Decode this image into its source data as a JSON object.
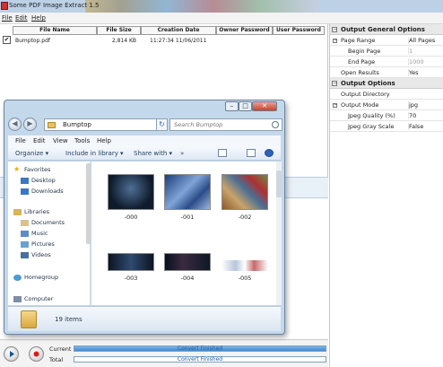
{
  "app": {
    "title": "Some PDF Image Extract 1.5",
    "menu": [
      "File",
      "Edit",
      "Help"
    ]
  },
  "file_table": {
    "columns": [
      "File Name",
      "File Size",
      "Creation Date",
      "Owner Password",
      "User Password"
    ],
    "rows": [
      {
        "checked": "✔",
        "name": "Bumptop.pdf",
        "size": "2,814 KB",
        "date": "11:27:34 11/06/2011",
        "owner": "",
        "user": ""
      }
    ]
  },
  "props": {
    "general_title": "Output General Options",
    "general": [
      {
        "key": "Page Range",
        "value": "All Pages"
      },
      {
        "key": "Begin Page",
        "value": "1"
      },
      {
        "key": "End Page",
        "value": "1000"
      },
      {
        "key": "Open Results",
        "value": "Yes"
      }
    ],
    "options_title": "Output Options",
    "options": [
      {
        "key": "Output Directory",
        "value": ""
      },
      {
        "key": "Output Mode",
        "value": "jpg"
      },
      {
        "key": "Jpeg Quality (%)",
        "value": "70"
      },
      {
        "key": "Jpeg Gray Scale",
        "value": "False"
      }
    ]
  },
  "progress": {
    "current_label": "Current",
    "total_label": "Total",
    "current_status": "Convert Finished",
    "total_status": "Convert Finished",
    "current_fraction": 1.0,
    "total_fraction": 0.0
  },
  "explorer": {
    "path": "Bumptop",
    "search_placeholder": "Search Bumptop",
    "menu": [
      "File",
      "Edit",
      "View",
      "Tools",
      "Help"
    ],
    "commands": [
      "Organize ▾",
      "Include in library ▾",
      "Share with ▾",
      "»"
    ],
    "nav": [
      {
        "label": "Favorites",
        "icon": "star-icon"
      },
      {
        "label": "Desktop",
        "icon": "desktop-icon"
      },
      {
        "label": "Downloads",
        "icon": "downloads-icon"
      },
      {
        "label": "Libraries",
        "icon": "libraries-icon"
      },
      {
        "label": "Documents",
        "icon": "documents-icon"
      },
      {
        "label": "Music",
        "icon": "music-icon"
      },
      {
        "label": "Pictures",
        "icon": "pictures-icon"
      },
      {
        "label": "Videos",
        "icon": "videos-icon"
      },
      {
        "label": "Homegroup",
        "icon": "homegroup-icon"
      },
      {
        "label": "Computer",
        "icon": "computer-icon"
      }
    ],
    "files": [
      "-000",
      "-001",
      "-002",
      "-003",
      "-004",
      "-005"
    ],
    "item_count": "19 items"
  },
  "colors": {
    "titlebar": "#bcd1e5",
    "progress_fill": "#3e8ad6",
    "explorer_frame": "#c4d8ec"
  }
}
